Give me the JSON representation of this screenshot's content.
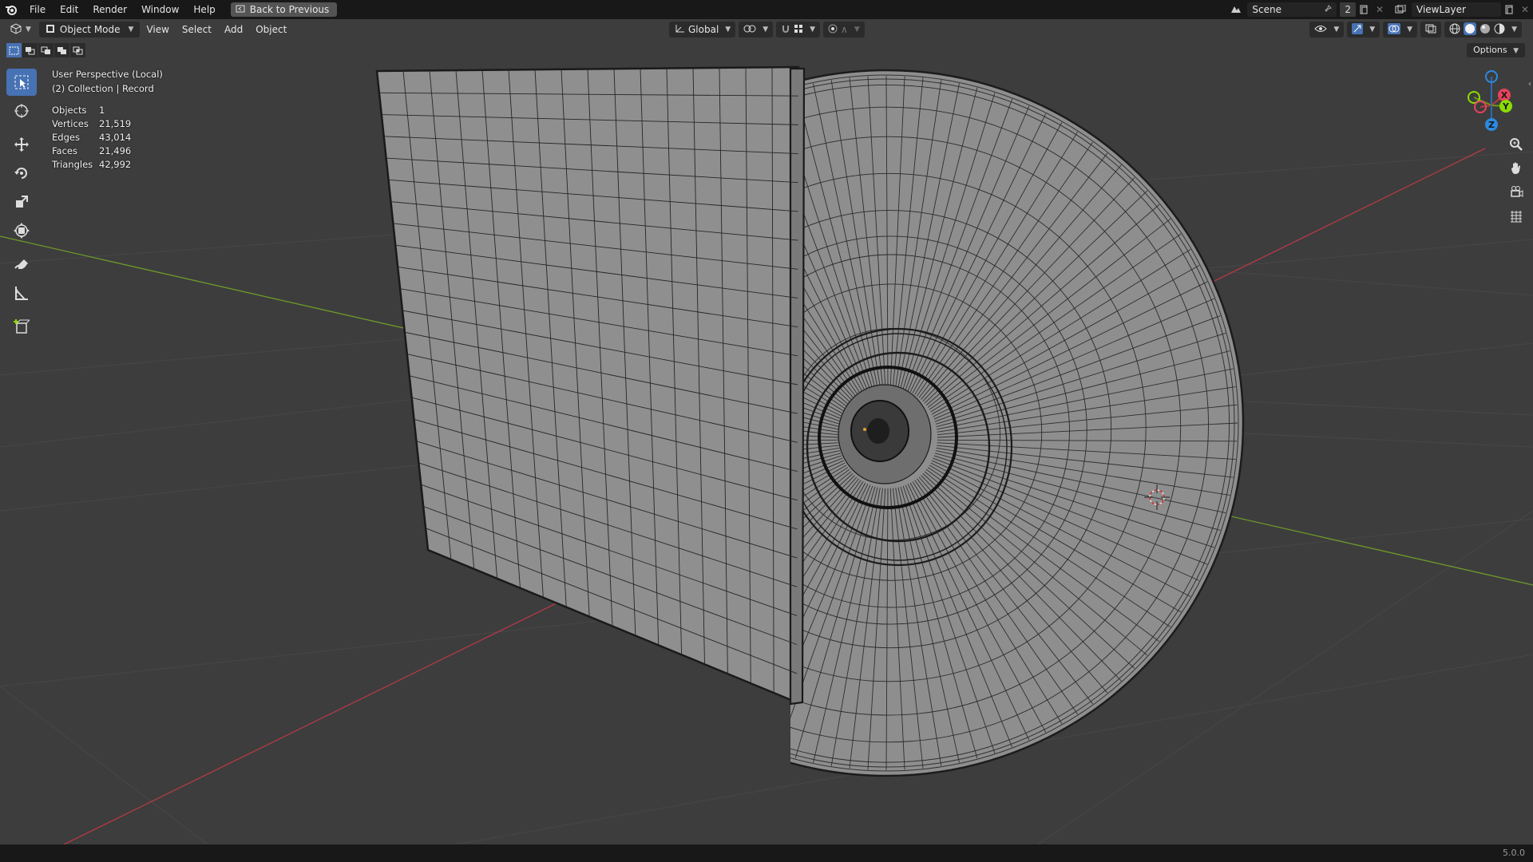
{
  "menubar": {
    "items": [
      "File",
      "Edit",
      "Render",
      "Window",
      "Help"
    ],
    "back_button": "Back to Previous",
    "scene_name": "Scene",
    "scene_count": "2",
    "view_layer": "ViewLayer"
  },
  "header": {
    "mode": "Object Mode",
    "menus": [
      "View",
      "Select",
      "Add",
      "Object"
    ],
    "orientation": "Global"
  },
  "options_label": "Options",
  "overlay": {
    "view_name": "User Perspective (Local)",
    "collection": "(2) Collection | Record"
  },
  "stats": [
    {
      "label": "Objects",
      "value": "1"
    },
    {
      "label": "Vertices",
      "value": "21,519"
    },
    {
      "label": "Edges",
      "value": "43,014"
    },
    {
      "label": "Faces",
      "value": "21,496"
    },
    {
      "label": "Triangles",
      "value": "42,992"
    }
  ],
  "gizmo": {
    "x_label": "X",
    "y_label": "Y",
    "z_label": "Z",
    "x_color": "#e8435b",
    "y_color": "#8bdc00",
    "z_color": "#2b8ae0"
  },
  "status": {
    "version": "5.0.0"
  },
  "colors": {
    "viewport_bg": "#3d3d3d",
    "accent": "#4772b3",
    "x_axis_line": "#b33a45",
    "y_axis_line": "#6e9a2a",
    "mesh_fill": "#8e8e8e",
    "wire": "#1c1c1c"
  },
  "icons": {
    "logo": "blender-logo-icon",
    "tools": [
      "select-box-icon",
      "cursor-icon",
      "move-icon",
      "rotate-icon",
      "scale-icon",
      "transform-icon",
      "annotate-icon",
      "measure-icon",
      "add-cube-icon"
    ],
    "nav": [
      "zoom-icon",
      "pan-hand-icon",
      "camera-icon",
      "grid-ortho-icon"
    ]
  }
}
